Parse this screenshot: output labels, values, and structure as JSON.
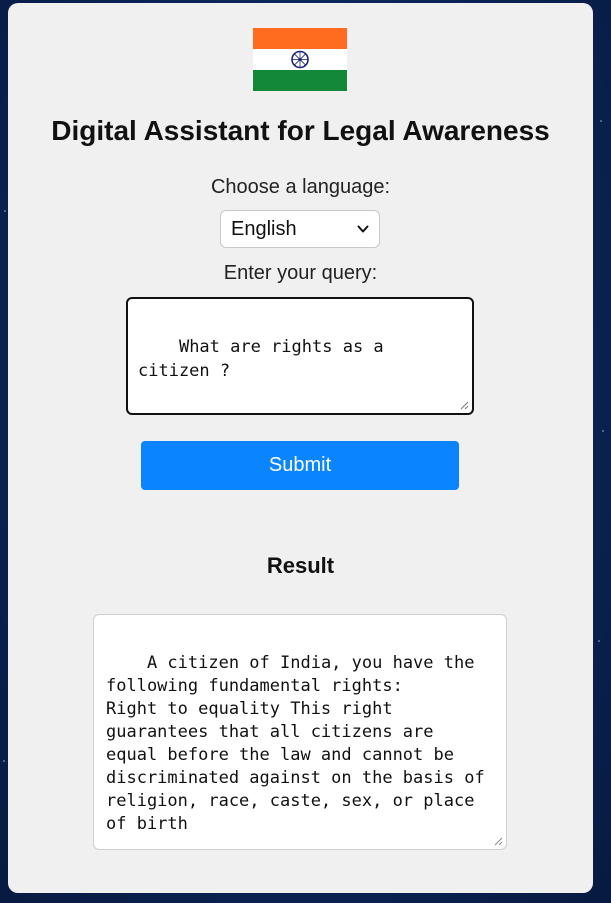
{
  "header": {
    "flag_icon": "india-flag-icon",
    "title": "Digital Assistant for Legal Awareness"
  },
  "form": {
    "language_label": "Choose a language:",
    "language_selected": "English",
    "query_label": "Enter your query:",
    "query_value": "What are rights as a citizen ?",
    "submit_label": "Submit"
  },
  "result": {
    "title": "Result",
    "text": "A citizen of India, you have the following fundamental rights:\nRight to equality This right guarantees that all citizens are equal before the law and cannot be discriminated against on the basis of religion, race, caste, sex, or place of birth"
  },
  "colors": {
    "saffron": "#FF6B1F",
    "green": "#138838",
    "chakra": "#1A237E",
    "accent": "#0A84FF"
  }
}
